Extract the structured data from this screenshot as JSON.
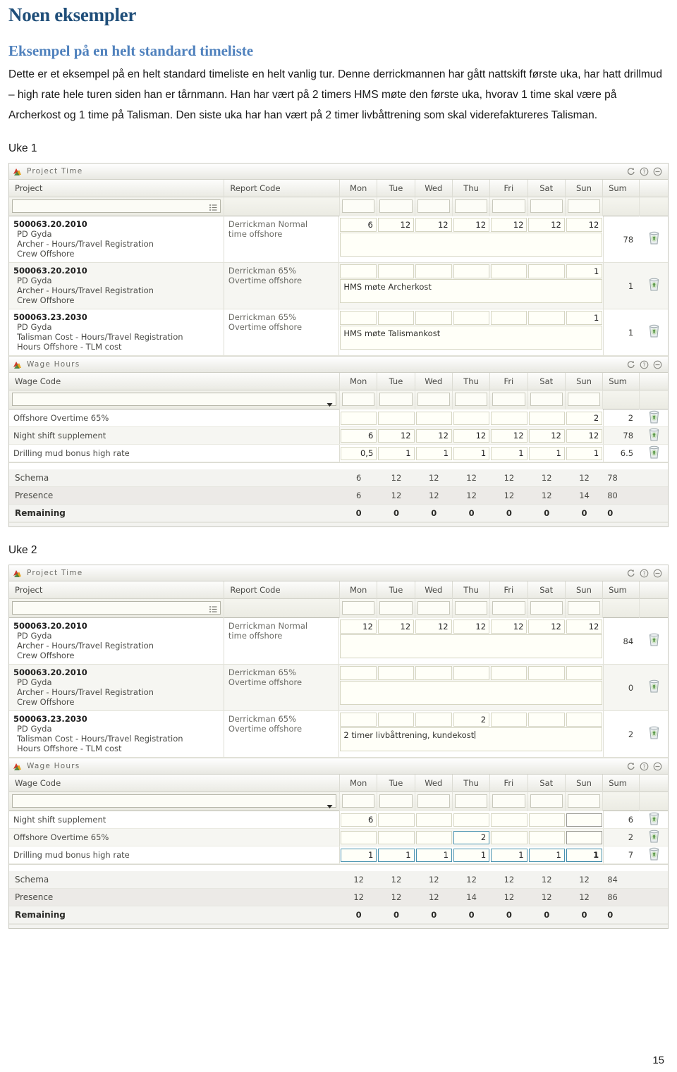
{
  "document": {
    "title": "Noen eksempler",
    "subtitle": "Eksempel på en helt standard timeliste",
    "paragraph": "Dette er et eksempel på en helt standard timeliste en helt vanlig tur. Denne derrickmannen har gått nattskift første uka, har hatt drillmud – high rate hele turen siden han er tårnmann. Han har vært på 2 timers HMS møte den første uka, hvorav 1 time skal være på Archerkost og 1 time på Talisman. Den siste uka har han vært på 2 timer livbåttrening som skal viderefaktureres Talisman.",
    "page_number": "15",
    "accent_title_color": "#1f4e79",
    "accent_subtitle_color": "#4f81bd"
  },
  "labels": {
    "week1": "Uke 1",
    "week2": "Uke 2"
  },
  "panels": {
    "project_time_title": "Project Time",
    "wage_hours_title": "Wage Hours",
    "icons": {
      "panel_logo": "archer-logo-icon",
      "refresh": "refresh-icon",
      "help": "help-icon",
      "collapse": "collapse-icon",
      "picker": "list-picker-icon",
      "dropdown": "chevron-down-icon",
      "delete": "trash-icon"
    }
  },
  "columns": {
    "project": "Project",
    "report_code": "Report Code",
    "wage_code": "Wage Code",
    "days": [
      "Mon",
      "Tue",
      "Wed",
      "Thu",
      "Fri",
      "Sat",
      "Sun"
    ],
    "sum": "Sum"
  },
  "week1": {
    "project_time": {
      "rows": [
        {
          "project_code": "500063.20.2010",
          "project_lines": [
            "PD Gyda",
            "Archer - Hours/Travel Registration",
            "Crew Offshore"
          ],
          "report_code": [
            "Derrickman Normal",
            "time offshore"
          ],
          "days": [
            "6",
            "12",
            "12",
            "12",
            "12",
            "12",
            "12"
          ],
          "comment": "",
          "sum": "78"
        },
        {
          "project_code": "500063.20.2010",
          "project_lines": [
            "PD Gyda",
            "Archer - Hours/Travel Registration",
            "Crew Offshore"
          ],
          "report_code": [
            "Derrickman 65%",
            "Overtime offshore"
          ],
          "days": [
            "",
            "",
            "",
            "",
            "",
            "",
            "1"
          ],
          "comment": "HMS møte Archerkost",
          "sum": "1"
        },
        {
          "project_code": "500063.23.2030",
          "project_lines": [
            "PD Gyda",
            "Talisman Cost - Hours/Travel Registration",
            "Hours Offshore - TLM cost"
          ],
          "report_code": [
            "Derrickman 65%",
            "Overtime offshore"
          ],
          "days": [
            "",
            "",
            "",
            "",
            "",
            "",
            "1"
          ],
          "comment": "HMS møte Talismankost",
          "sum": "1"
        }
      ]
    },
    "wage_hours": {
      "rows": [
        {
          "wage_code": "Offshore Overtime 65%",
          "days": [
            "",
            "",
            "",
            "",
            "",
            "",
            "2"
          ],
          "sum": "2"
        },
        {
          "wage_code": "Night shift supplement",
          "days": [
            "6",
            "12",
            "12",
            "12",
            "12",
            "12",
            "12"
          ],
          "sum": "78"
        },
        {
          "wage_code": "Drilling mud bonus high rate",
          "days": [
            "0,5",
            "1",
            "1",
            "1",
            "1",
            "1",
            "1"
          ],
          "sum": "6.5"
        }
      ]
    },
    "summary": [
      {
        "label": "Schema",
        "values": [
          "6",
          "12",
          "12",
          "12",
          "12",
          "12",
          "12"
        ],
        "sum": "78"
      },
      {
        "label": "Presence",
        "values": [
          "6",
          "12",
          "12",
          "12",
          "12",
          "12",
          "14"
        ],
        "sum": "80"
      },
      {
        "label": "Remaining",
        "values": [
          "0",
          "0",
          "0",
          "0",
          "0",
          "0",
          "0"
        ],
        "sum": "0"
      }
    ]
  },
  "week2": {
    "project_time": {
      "rows": [
        {
          "project_code": "500063.20.2010",
          "project_lines": [
            "PD Gyda",
            "Archer - Hours/Travel Registration",
            "Crew Offshore"
          ],
          "report_code": [
            "Derrickman Normal",
            "time offshore"
          ],
          "days": [
            "12",
            "12",
            "12",
            "12",
            "12",
            "12",
            "12"
          ],
          "comment": "",
          "sum": "84"
        },
        {
          "project_code": "500063.20.2010",
          "project_lines": [
            "PD Gyda",
            "Archer - Hours/Travel Registration",
            "Crew Offshore"
          ],
          "report_code": [
            "Derrickman 65%",
            "Overtime offshore"
          ],
          "days": [
            "",
            "",
            "",
            "",
            "",
            "",
            ""
          ],
          "comment": "",
          "sum": "0"
        },
        {
          "project_code": "500063.23.2030",
          "project_lines": [
            "PD Gyda",
            "Talisman Cost - Hours/Travel Registration",
            "Hours Offshore - TLM cost"
          ],
          "report_code": [
            "Derrickman 65%",
            "Overtime offshore"
          ],
          "days": [
            "",
            "",
            "",
            "2",
            "",
            "",
            ""
          ],
          "comment": "2 timer livbåttrening, kundekost",
          "sum": "2"
        }
      ]
    },
    "wage_hours": {
      "rows": [
        {
          "wage_code": "Night shift supplement",
          "days": [
            "6",
            "",
            "",
            "",
            "",
            "",
            ""
          ],
          "sum": "6"
        },
        {
          "wage_code": "Offshore Overtime 65%",
          "days": [
            "",
            "",
            "",
            "2",
            "",
            "",
            ""
          ],
          "sum": "2"
        },
        {
          "wage_code": "Drilling mud bonus high rate",
          "days": [
            "1",
            "1",
            "1",
            "1",
            "1",
            "1",
            "1"
          ],
          "sum": "7"
        }
      ]
    },
    "summary": [
      {
        "label": "Schema",
        "values": [
          "12",
          "12",
          "12",
          "12",
          "12",
          "12",
          "12"
        ],
        "sum": "84"
      },
      {
        "label": "Presence",
        "values": [
          "12",
          "12",
          "12",
          "14",
          "12",
          "12",
          "12"
        ],
        "sum": "86"
      },
      {
        "label": "Remaining",
        "values": [
          "0",
          "0",
          "0",
          "0",
          "0",
          "0",
          "0"
        ],
        "sum": "0"
      }
    ]
  }
}
